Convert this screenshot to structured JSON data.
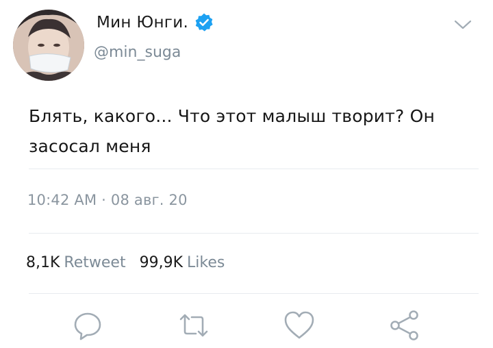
{
  "user": {
    "display_name": "Мин Юнги.",
    "handle": "@min_suga",
    "verified": true
  },
  "tweet": {
    "text": "Блять, какого... Что этот малыш творит? Он засосал меня",
    "timestamp": "10:42 AM · 08 авг. 20"
  },
  "stats": {
    "retweets_count": "8,1K",
    "retweets_label": "Retweet",
    "likes_count": "99,9K",
    "likes_label": "Likes"
  },
  "actions": {
    "reply": "reply-icon",
    "retweet": "retweet-icon",
    "like": "heart-icon",
    "share": "share-icon"
  },
  "colors": {
    "verified_blue": "#1da1f2",
    "secondary_text": "#7c8a96",
    "icon_gray": "#a2acb5",
    "divider": "#e7ebef"
  }
}
